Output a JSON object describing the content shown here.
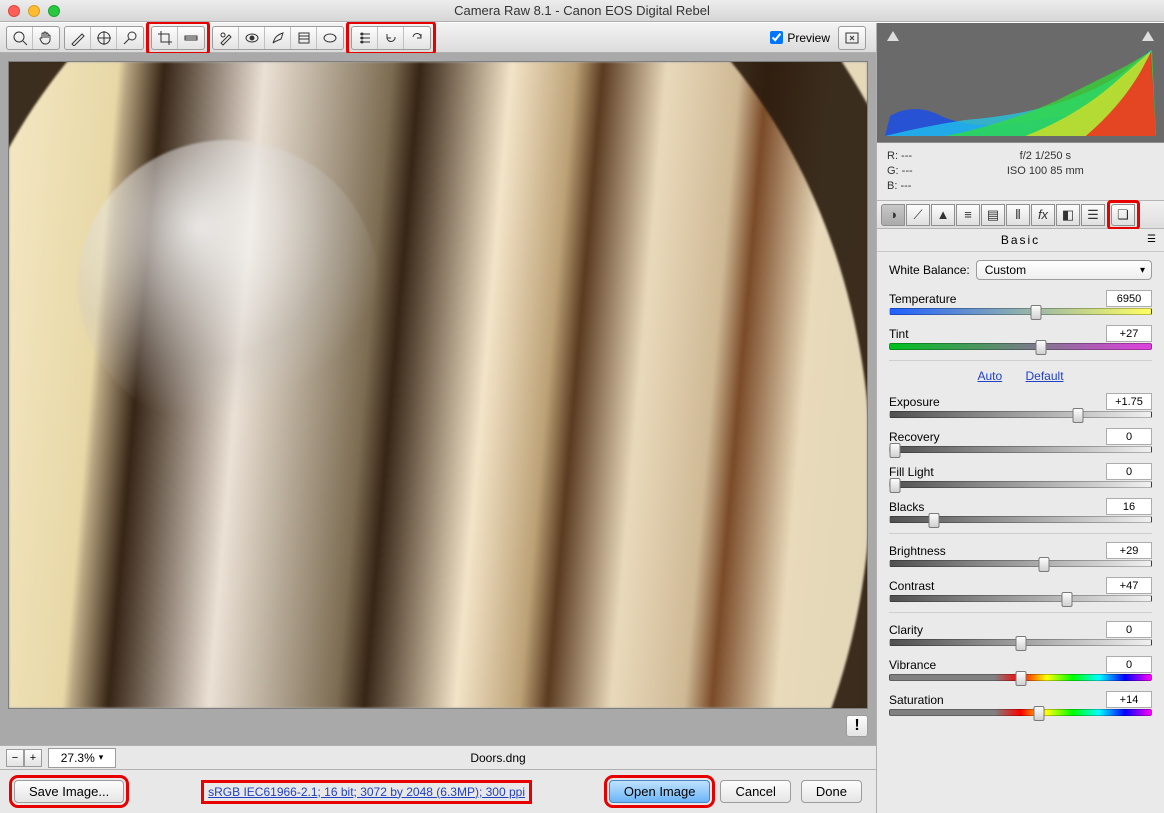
{
  "title": "Camera Raw 8.1  -  Canon EOS Digital Rebel",
  "preview_label": "Preview",
  "zoom": "27.3%",
  "filename": "Doors.dng",
  "workflow_link": "sRGB IEC61966-2.1; 16 bit; 3072 by 2048 (6.3MP); 300 ppi",
  "exif": {
    "r": "R:   ---",
    "g": "G:   ---",
    "b": "B:   ---",
    "aperture_shutter": "f/2   1/250 s",
    "iso_focal": "ISO 100    85 mm"
  },
  "panel_title": "Basic",
  "wb_label": "White Balance:",
  "wb_value": "Custom",
  "auto": "Auto",
  "default": "Default",
  "sliders": {
    "temperature": {
      "label": "Temperature",
      "value": "6950",
      "pos": 56
    },
    "tint": {
      "label": "Tint",
      "value": "+27",
      "pos": 58
    },
    "exposure": {
      "label": "Exposure",
      "value": "+1.75",
      "pos": 72
    },
    "recovery": {
      "label": "Recovery",
      "value": "0",
      "pos": 0
    },
    "filllight": {
      "label": "Fill Light",
      "value": "0",
      "pos": 0
    },
    "blacks": {
      "label": "Blacks",
      "value": "16",
      "pos": 17
    },
    "brightness": {
      "label": "Brightness",
      "value": "+29",
      "pos": 59
    },
    "contrast": {
      "label": "Contrast",
      "value": "+47",
      "pos": 68
    },
    "clarity": {
      "label": "Clarity",
      "value": "0",
      "pos": 50
    },
    "vibrance": {
      "label": "Vibrance",
      "value": "0",
      "pos": 50
    },
    "saturation": {
      "label": "Saturation",
      "value": "+14",
      "pos": 57
    }
  },
  "buttons": {
    "save": "Save Image...",
    "open": "Open Image",
    "cancel": "Cancel",
    "done": "Done"
  }
}
